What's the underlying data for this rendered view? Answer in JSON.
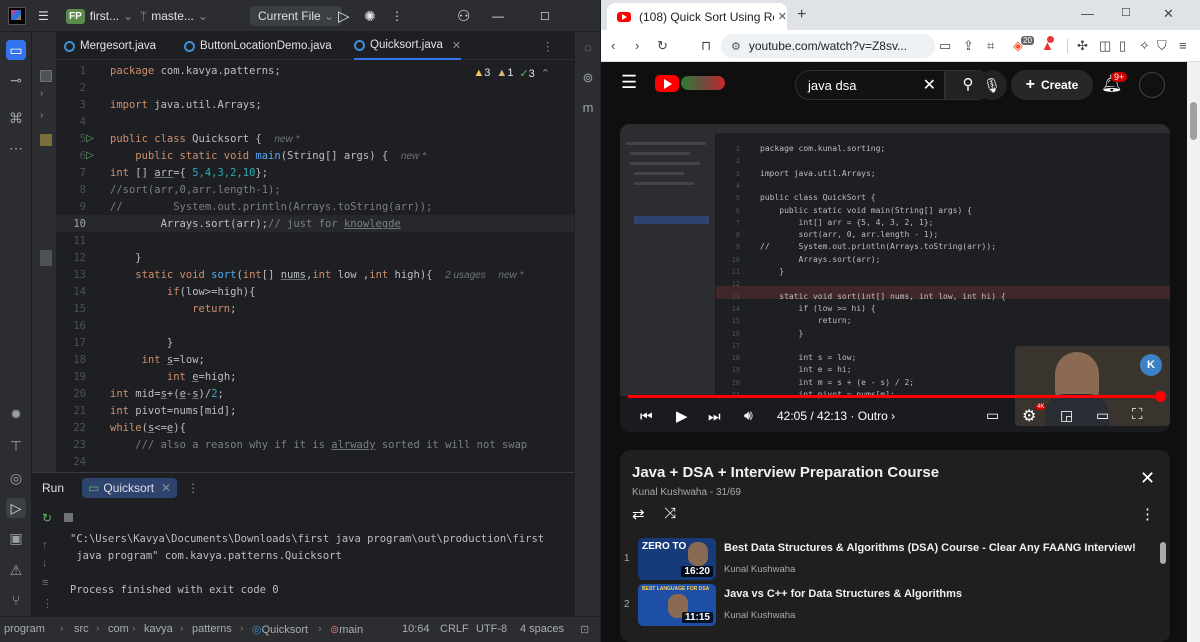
{
  "ide": {
    "project_badge": "FP",
    "project_name": "first...",
    "branch": "maste...",
    "run_config": "Current File",
    "tabs": [
      {
        "label": "Mergesort.java"
      },
      {
        "label": "ButtonLocationDemo.java"
      },
      {
        "label": "Quicksort.java"
      }
    ],
    "inspections": {
      "warnings": "3",
      "weak": "1",
      "typos": "3"
    },
    "line_numbers": [
      "1",
      "2",
      "3",
      "4",
      "5",
      "6",
      "7",
      "8",
      "9",
      "10",
      "11",
      "12",
      "13",
      "14",
      "15",
      "16",
      "17",
      "18",
      "19",
      "20",
      "21",
      "22",
      "23",
      "24"
    ],
    "hints": {
      "new1": "new *",
      "new2": "new *",
      "usages": "2 usages",
      "new3": "new *"
    },
    "code": {
      "l1a": "package",
      "l1b": " com.kavya.patterns;",
      "l3a": "import",
      "l3b": " java.util.Arrays;",
      "l5a": "public class",
      "l5b": " Quicksort {",
      "l6a": "public static void",
      "l6b": " main",
      "l6c": "(String[] args) {",
      "l7a": "int",
      "l7b": " [] ",
      "l7c": "arr",
      "l7d": "={ ",
      "l7e": "5,4,3,2,10",
      "l7f": "};",
      "l8": "//sort(arr,0,arr.length-1);",
      "l9": "//        System.out.println(Arrays.toString(arr));",
      "l10a": "Arrays.",
      "l10b": "sort",
      "l10c": "(arr);",
      "l10d": "// just for ",
      "l10e": "knowlegde",
      "l12": "}",
      "l13a": "static void",
      "l13b": " sort",
      "l13c": "(",
      "l13d": "int",
      "l13e": "[] ",
      "l13f": "nums",
      "l13g": ",",
      "l13h": "int",
      "l13i": " low ,",
      "l13j": "int",
      "l13k": " high){",
      "l14a": "if",
      "l14b": "(low>=high){",
      "l15a": "return",
      "l15b": ";",
      "l17": "}",
      "l18a": "int",
      "l18b": " ",
      "l18c": "s",
      "l18d": "=low;",
      "l19a": "int",
      "l19b": " ",
      "l19c": "e",
      "l19d": "=high;",
      "l20a": "int",
      "l20b": " mid=",
      "l20c": "s",
      "l20d": "+(",
      "l20e": "e",
      "l20f": "-",
      "l20g": "s",
      "l20h": ")/",
      "l20i": "2",
      "l20j": ";",
      "l21a": "int",
      "l21b": " pivot=nums[mid];",
      "l22a": "while",
      "l22b": "(",
      "l22c": "s",
      "l22d": "<=",
      "l22e": "e",
      "l22f": "){",
      "l23a": "/// also a reason why if it is ",
      "l23b": "alrwady",
      "l23c": " sorted it will not swap"
    },
    "run_panel": {
      "tab_run": "Run",
      "tab_config": "Quicksort",
      "line1": "\"C:\\Users\\Kavya\\Documents\\Downloads\\first java program\\out\\production\\first",
      "line2": " java program\" com.kavya.patterns.Quicksort",
      "line3": "Process finished with exit code 0"
    },
    "status": {
      "crumb1": "program",
      "crumb2": "src",
      "crumb3": "com",
      "crumb4": "kavya",
      "crumb5": "patterns",
      "crumb6": "Quicksort",
      "crumb7": "main",
      "position": "10:64",
      "line_sep": "CRLF",
      "encoding": "UTF-8",
      "indent": "4 spaces"
    }
  },
  "browser": {
    "tab_title": "(108) Quick Sort Using Recu",
    "url": "youtube.com/watch?v=Z8sv...",
    "ext_badge": "20",
    "youtube": {
      "search_value": "java dsa",
      "create_label": "Create",
      "notif_count": "9+",
      "video": {
        "time_current": "42:05",
        "time_total": "42:13",
        "chapter": "Outro",
        "progress": 0.997,
        "inner_code": [
          "package com.kunal.sorting;",
          "",
          "import java.util.Arrays;",
          "",
          "public class QuickSort {",
          "    public static void main(String[] args) {",
          "        int[] arr = {5, 4, 3, 2, 1};",
          "        sort(arr, 0, arr.length - 1);",
          "//      System.out.println(Arrays.toString(arr));",
          "        Arrays.sort(arr);",
          "    }",
          "",
          "    static void sort(int[] nums, int low, int hi) {",
          "        if (low >= hi) {",
          "            return;",
          "        }",
          "",
          "        int s = low;",
          "        int e = hi;",
          "        int m = s + (e - s) / 2;",
          "        int pivot = nums[m];"
        ],
        "inner_lines": [
          "1",
          "2",
          "3",
          "4",
          "5",
          "6",
          "7",
          "8",
          "9",
          "10",
          "11",
          "12",
          "13",
          "14",
          "15",
          "16",
          "17",
          "18",
          "19",
          "20",
          "21"
        ]
      },
      "playlist": {
        "title": "Java + DSA + Interview Preparation Course",
        "author": "Kunal Kushwaha",
        "position": "31/69",
        "items": [
          {
            "num": "1",
            "title": "Best Data Structures & Algorithms (DSA) Course - Clear Any FAANG Interview!",
            "channel": "Kunal Kushwaha",
            "duration": "16:20",
            "thumb_text": "ZERO TO"
          },
          {
            "num": "2",
            "title": "Java vs C++ for Data Structures & Algorithms",
            "channel": "Kunal Kushwaha",
            "duration": "11:15",
            "thumb_text": "BEST LANGUAGE FOR DSA"
          }
        ]
      }
    }
  }
}
